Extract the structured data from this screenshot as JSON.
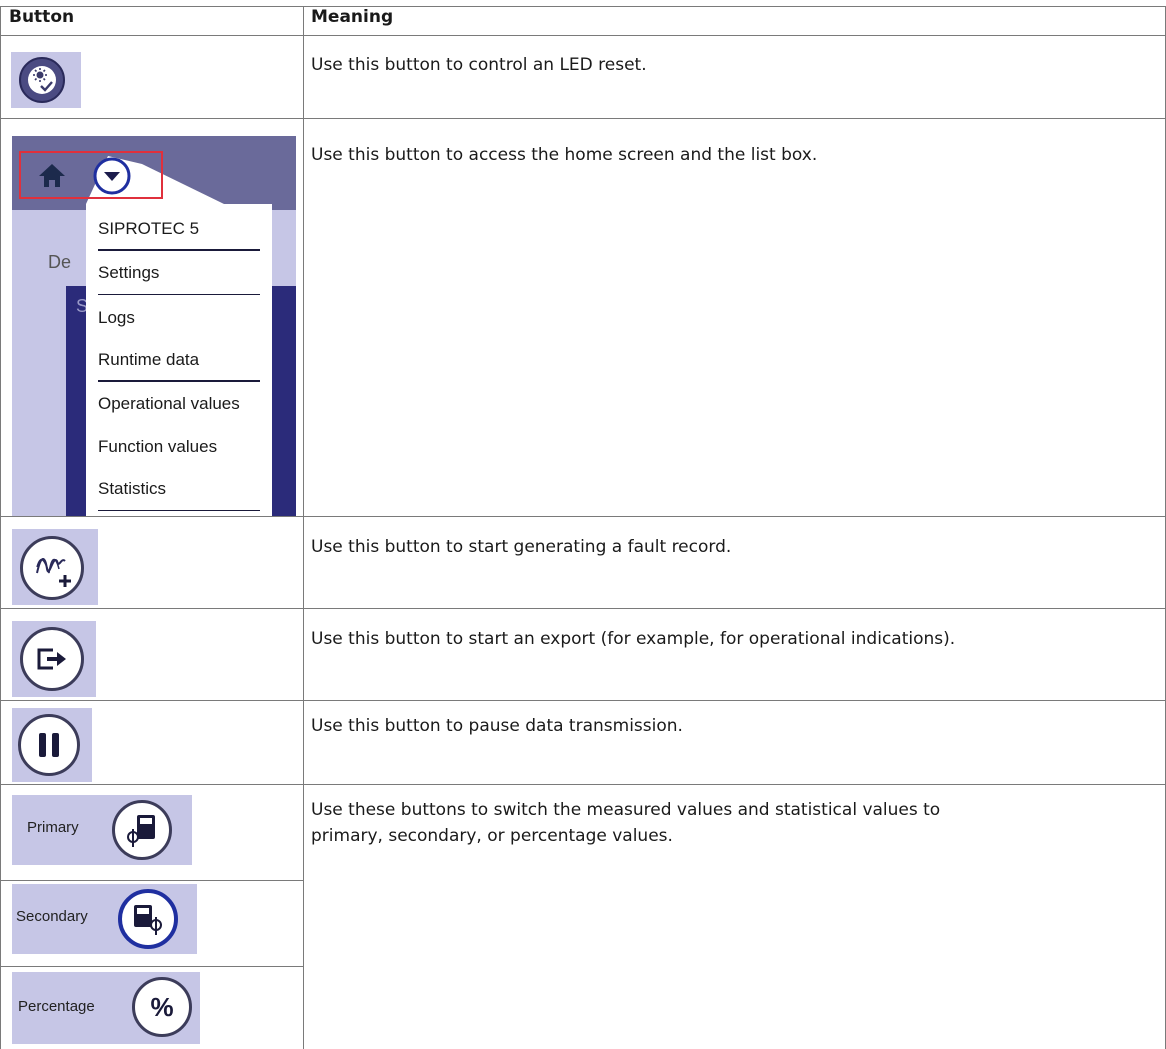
{
  "table": {
    "header_button": "Button",
    "header_meaning": "Meaning"
  },
  "rows": [
    {
      "meaning": "Use this button to control an LED reset."
    },
    {
      "meaning": "Use this button to access the home screen and the list box."
    },
    {
      "meaning": "Use this button to start generating a fault record."
    },
    {
      "meaning": "Use this button to start an export (for example, for operational indications)."
    },
    {
      "meaning": "Use this button to pause data transmission."
    },
    {
      "meaning_line1": "Use these buttons to switch the measured values and statistical values to",
      "meaning_line2": "primary, secondary, or percentage values."
    }
  ],
  "menu": {
    "background_fragment": "De",
    "background_fragment2": "S",
    "items": [
      "SIPROTEC 5",
      "Settings",
      "Logs",
      "Runtime data",
      "Operational values",
      "Function values",
      "Statistics"
    ]
  },
  "value_buttons": {
    "primary": "Primary",
    "secondary": "Secondary",
    "percentage": "Percentage",
    "percent_symbol": "%"
  },
  "colors": {
    "panel_bg": "#c6c6e6",
    "header_bar": "#6a6a9a",
    "dark_blue": "#2b2b7a",
    "highlight_red": "#e0303c",
    "icon_ring": "#1c1c4c"
  }
}
